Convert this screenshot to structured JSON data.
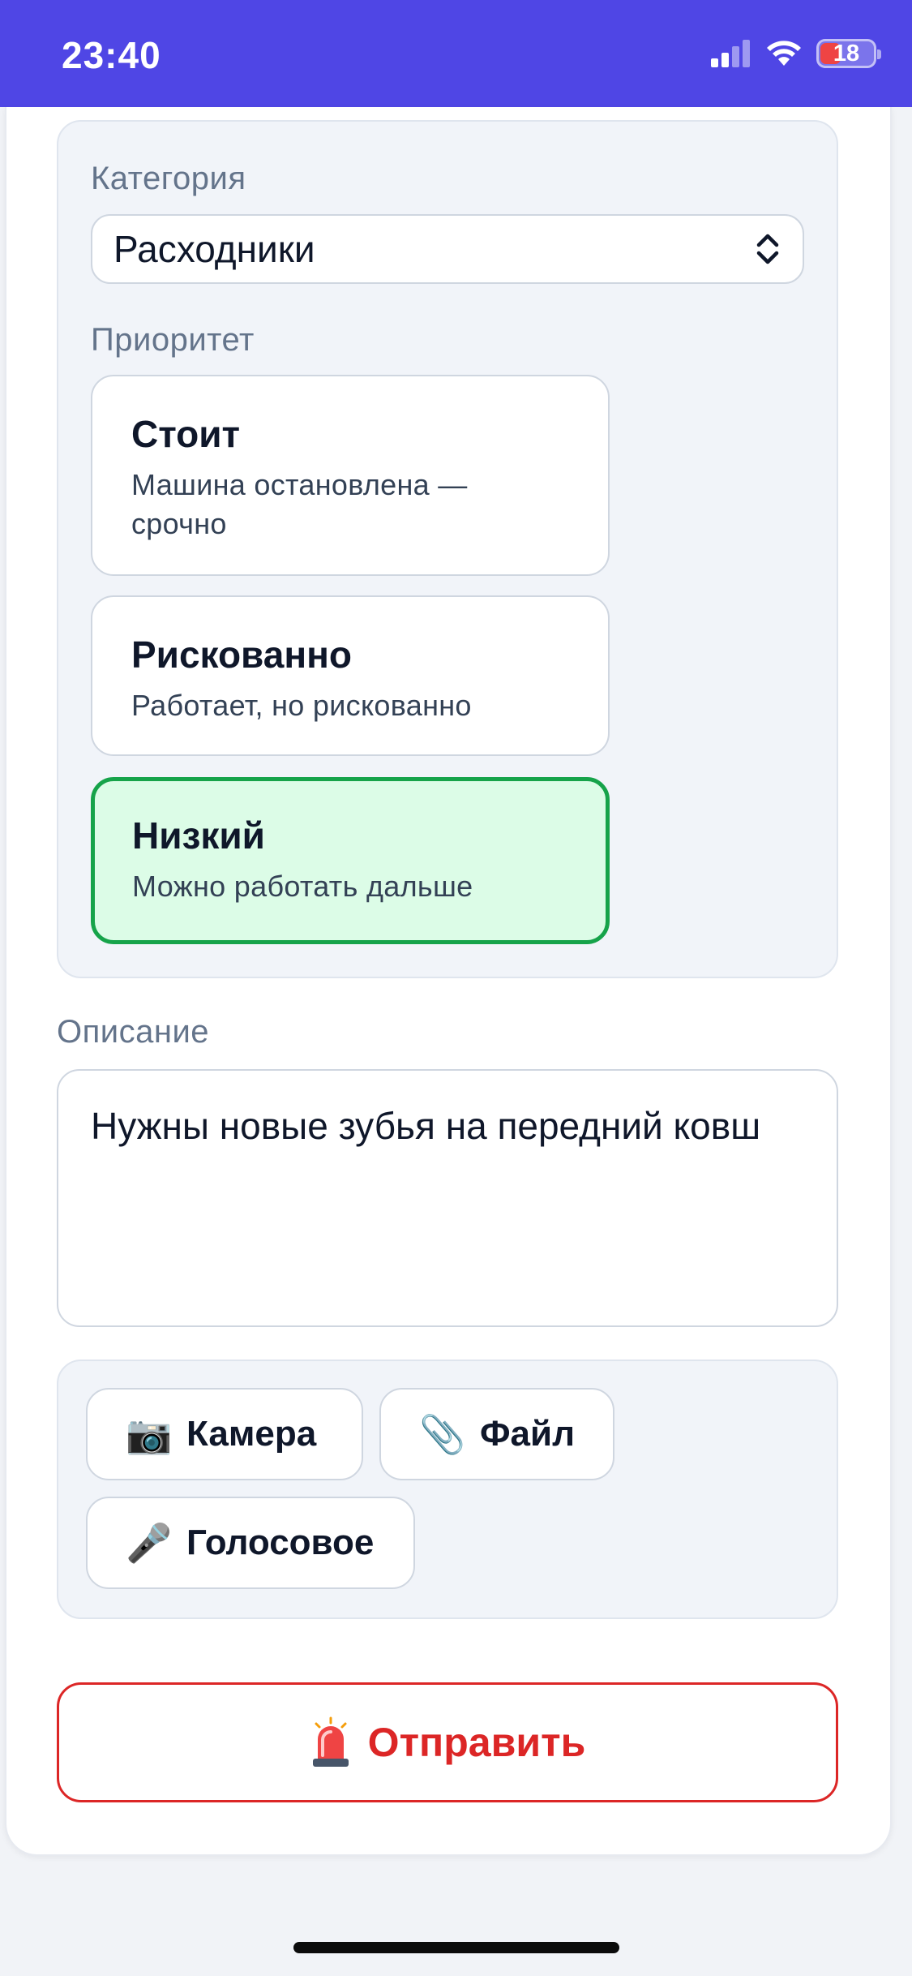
{
  "status_bar": {
    "time": "23:40",
    "battery_level": "18",
    "battery_percent": 18,
    "icons": [
      "cellular-signal-icon",
      "wifi-icon",
      "battery-icon"
    ],
    "background_color": "#4f46e5"
  },
  "form": {
    "category": {
      "label": "Категория",
      "value": "Расходники"
    },
    "priority": {
      "label": "Приоритет",
      "options": [
        {
          "title": "Стоит",
          "description": "Машина остановлена — срочно",
          "selected": false
        },
        {
          "title": "Рискованно",
          "description": "Работает, но рискованно",
          "selected": false
        },
        {
          "title": "Низкий",
          "description": "Можно работать дальше",
          "selected": true
        }
      ],
      "selected_color": "#16a34a"
    },
    "description": {
      "label": "Описание",
      "value": "Нужны новые зубья на передний ковш"
    },
    "attachments": {
      "camera": {
        "icon": "camera-icon",
        "emoji": "📷",
        "label": "Камера"
      },
      "file": {
        "icon": "paperclip-icon",
        "emoji": "📎",
        "label": "Файл"
      },
      "voice": {
        "icon": "microphone-icon",
        "emoji": "🎤",
        "label": "Голосовое"
      }
    },
    "submit": {
      "icon": "siren-icon",
      "label": "Отправить",
      "color": "#dc2626"
    }
  }
}
